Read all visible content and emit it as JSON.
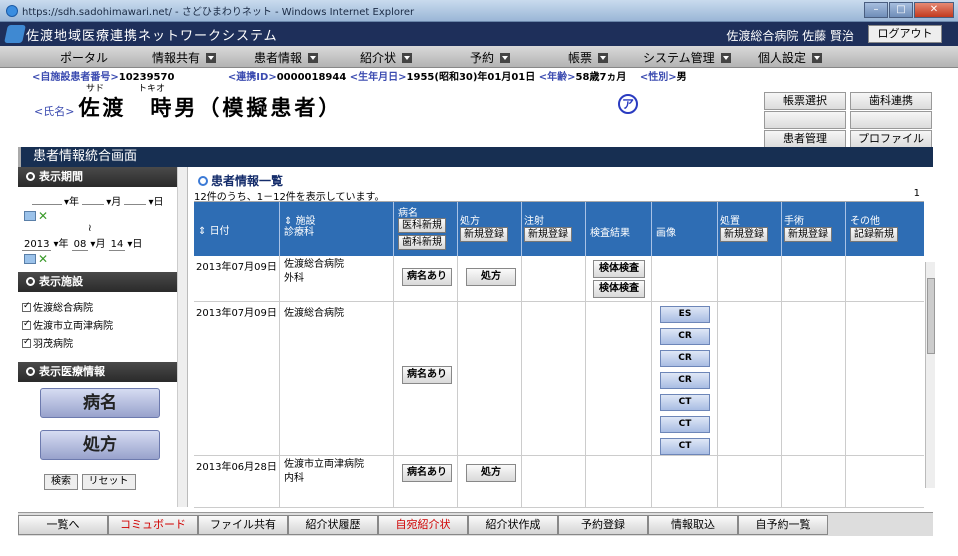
{
  "window": {
    "title": "https://sdh.sadohimawari.net/ - さどひまわりネット - Windows Internet Explorer"
  },
  "app": {
    "title": "佐渡地域医療連携ネットワークシステム",
    "user": "佐渡総合病院 佐藤 賢治",
    "logout": "ログアウト"
  },
  "menu": [
    "ポータル",
    "情報共有",
    "患者情報",
    "紹介状",
    "予約",
    "帳票",
    "システム管理",
    "個人設定"
  ],
  "patient": {
    "id_label": "<自施設患者番号>",
    "id": "10239570",
    "link_label": "<連携ID>",
    "link_id": "0000018944",
    "dob_label": "<生年月日>",
    "dob": "1955(昭和30)年01月01日",
    "age_label": "<年齢>",
    "age": "58歳7ヵ月",
    "sex_label": "<性別>",
    "sex": "男",
    "kana_family": "サド",
    "kana_given": "トキオ",
    "name_label": "<氏名>",
    "name": "佐渡　時男（模擬患者）",
    "mark": "ア"
  },
  "rightbuttons": {
    "report": "帳票選択",
    "dental": "歯科連携",
    "manage": "患者管理",
    "profile": "プロファイル"
  },
  "page_title": "患者情報統合画面",
  "sidebar": {
    "period_header": "表示期間",
    "from": {
      "year": "",
      "month": "",
      "day": ""
    },
    "year_unit": "年",
    "month_unit": "月",
    "day_unit": "日",
    "tilde": "≀",
    "to": {
      "year": "2013",
      "month": "08",
      "day": "14"
    },
    "facility_header": "表示施設",
    "facilities": [
      "佐渡総合病院",
      "佐渡市立両津病院",
      "羽茂病院"
    ],
    "medinfo_header": "表示医療情報",
    "btn_disease": "病名",
    "btn_prescription": "処方",
    "search": "検索",
    "reset": "リセット"
  },
  "main": {
    "title": "患者情報一覧",
    "count_text": "12件のうち、1－12件を表示しています。",
    "page": "1",
    "headers": {
      "date": "日付",
      "facility": "施設",
      "dept": "診療科",
      "disease": "病名",
      "disease_new_med": "医科新規",
      "disease_new_dental": "歯科新規",
      "rx": "処方",
      "rx_new": "新規登録",
      "inj": "注射",
      "inj_new": "新規登録",
      "lab": "検査結果",
      "img": "画像",
      "proc": "処置",
      "proc_new": "新規登録",
      "surg": "手術",
      "surg_new": "新規登録",
      "other": "その他",
      "other_new": "記録新規"
    },
    "rows": [
      {
        "date": "2013年07月09日",
        "facility": "佐渡総合病院",
        "dept": "外科",
        "disease": "病名あり",
        "rx": "処方",
        "lab": [
          "検体検査",
          "検体検査"
        ],
        "img": []
      },
      {
        "date": "2013年07月09日",
        "facility": "佐渡総合病院",
        "dept": "",
        "disease": "病名あり",
        "rx": "",
        "lab": [],
        "img": [
          "ES",
          "CR",
          "CR",
          "CR",
          "CT",
          "CT",
          "CT"
        ]
      },
      {
        "date": "2013年06月28日",
        "facility": "佐渡市立両津病院",
        "dept": "内科",
        "disease": "病名あり",
        "rx": "処方",
        "lab": [],
        "img": []
      }
    ]
  },
  "taskbar": [
    "一覧へ",
    "コミュボード",
    "ファイル共有",
    "紹介状履歴",
    "自宛紹介状",
    "紹介状作成",
    "予約登録",
    "情報取込",
    "自予約一覧"
  ],
  "colors": {
    "navy": "#1e2f5a",
    "header_blue": "#2e6db4",
    "red_text": "#d00000"
  }
}
